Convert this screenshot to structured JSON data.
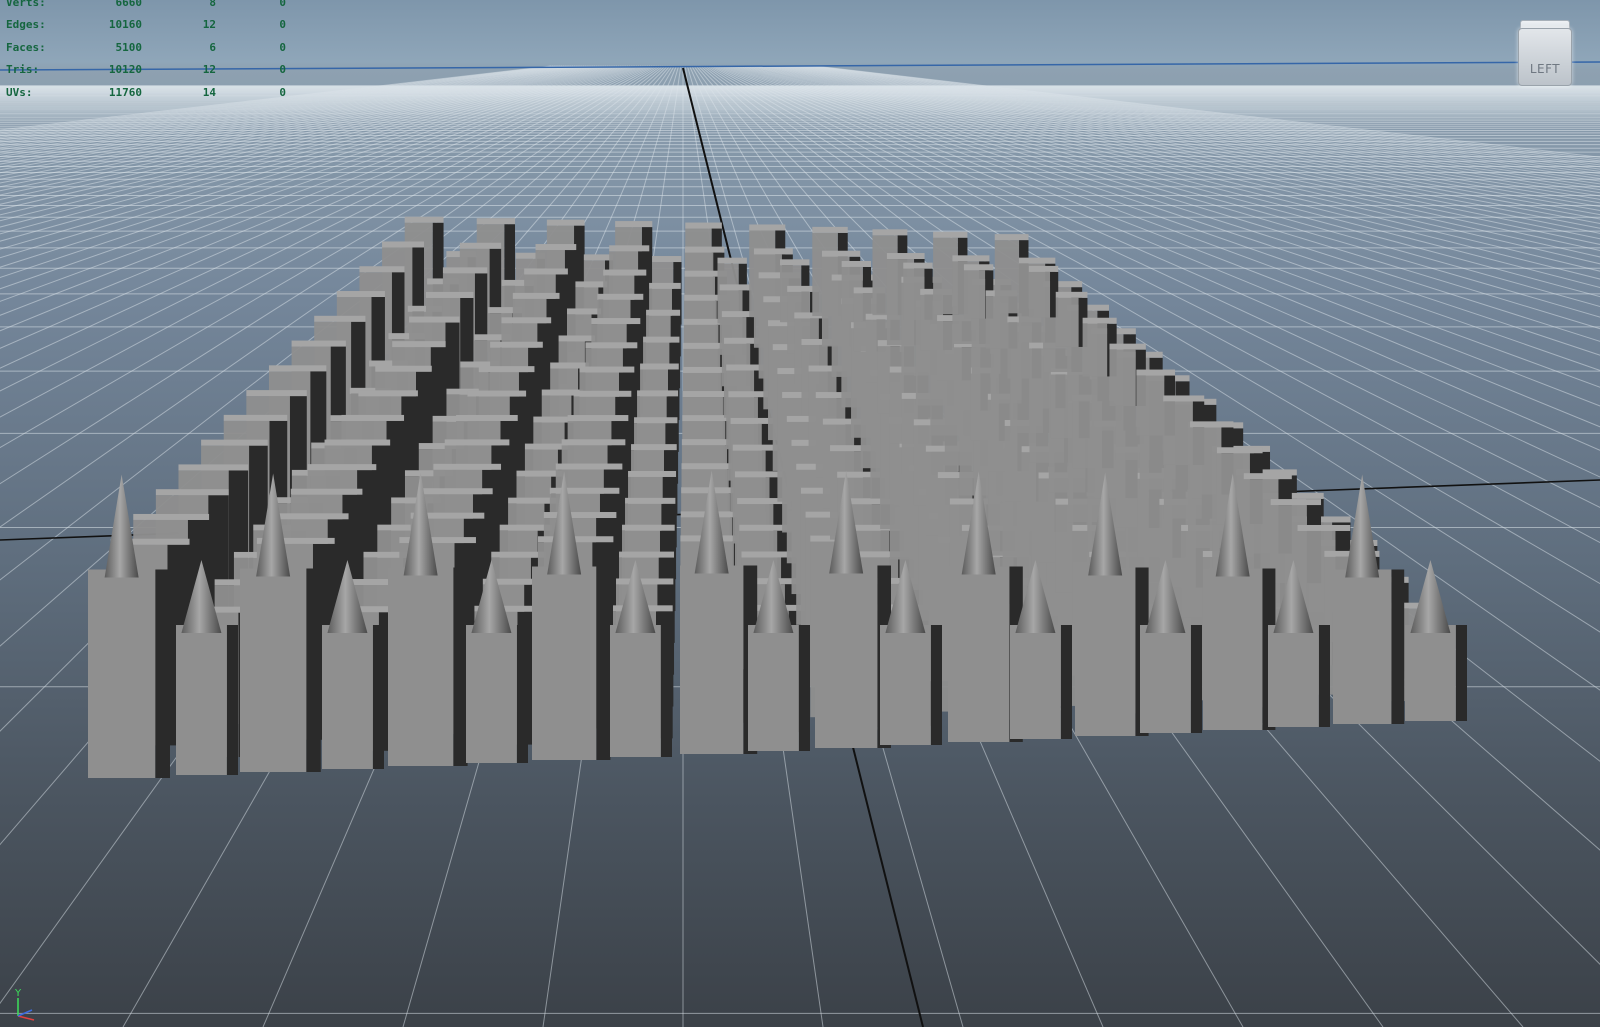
{
  "hud": {
    "rows": [
      {
        "label": "Verts:",
        "c1": "6660",
        "c2": "8",
        "c3": "0"
      },
      {
        "label": "Edges:",
        "c1": "10160",
        "c2": "12",
        "c3": "0"
      },
      {
        "label": "Faces:",
        "c1": "5100",
        "c2": "6",
        "c3": "0"
      },
      {
        "label": "Tris:",
        "c1": "10120",
        "c2": "12",
        "c3": "0"
      },
      {
        "label": "UVs:",
        "c1": "11760",
        "c2": "14",
        "c3": "0"
      }
    ]
  },
  "viewcube": {
    "label": "LEFT",
    "icon": "view-cube-icon"
  },
  "axes_indicator": {
    "label": "Y",
    "icon": "axis-gizmo-icon"
  },
  "colors": {
    "hud_text": "#15663f",
    "sky_top": "#7e96ab",
    "ground_far": "#74869a",
    "ground_near": "#3b4148",
    "grid_line": "#dbe3ea",
    "axis_line": "#111111",
    "horizon_line": "#3566a8",
    "block_front": "#8f8f8f",
    "block_side": "#2a2a2a",
    "block_top": "#a5a5a5",
    "spike": "#7d7d7d"
  }
}
